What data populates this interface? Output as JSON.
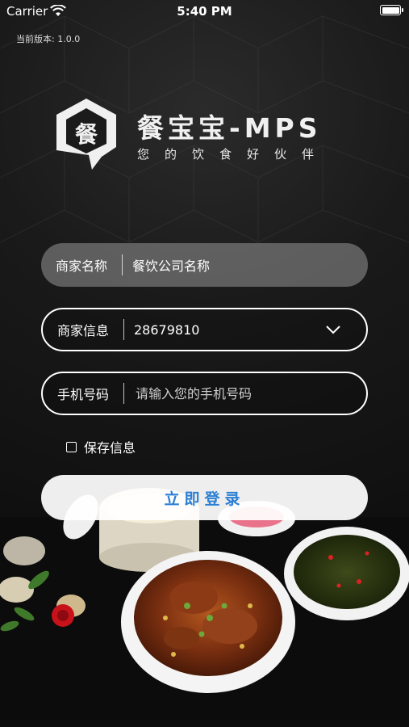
{
  "status_bar": {
    "carrier": "Carrier",
    "time": "5:40 PM"
  },
  "version_text": "当前版本: 1.0.0",
  "logo": {
    "title": "餐宝宝-MPS",
    "slogan": "您的饮食好伙伴",
    "mark_glyph": "餐"
  },
  "form": {
    "merchant_name": {
      "label": "商家名称",
      "value": "餐饮公司名称"
    },
    "merchant_info": {
      "label": "商家信息",
      "value": "28679810"
    },
    "phone": {
      "label": "手机号码",
      "placeholder": "请输入您的手机号码",
      "value": ""
    },
    "remember_label": "保存信息",
    "remember_checked": false,
    "login_label": "立即登录"
  },
  "colors": {
    "accent_text": "#2b7fd4",
    "button_bg": "#ffffff",
    "background": "#141414"
  },
  "icons": [
    "wifi-icon",
    "battery-icon",
    "logo-icon",
    "chevron-down-icon",
    "checkbox-icon"
  ]
}
